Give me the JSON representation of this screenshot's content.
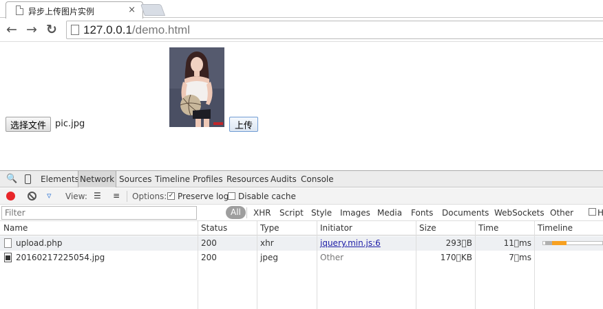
{
  "browser": {
    "tab_title": "异步上传图片实例",
    "tab_close": "×",
    "url_host": "127.0.0.1",
    "url_path": "/demo.html",
    "back_glyph": "←",
    "forward_glyph": "→",
    "reload_glyph": "↻"
  },
  "page": {
    "file_button_label": "选择文件",
    "file_name": "pic.jpg",
    "upload_button_label": "上传"
  },
  "devtools": {
    "tabs": [
      "Elements",
      "Network",
      "Sources",
      "Timeline",
      "Profiles",
      "Resources",
      "Audits",
      "Console"
    ],
    "active_tab": "Network",
    "view_label": "View:",
    "options_label": "Options:",
    "preserve_log_label": "Preserve log",
    "preserve_log_checked": true,
    "disable_cache_label": "Disable cache",
    "disable_cache_checked": false,
    "filter_placeholder": "Filter",
    "type_filters": [
      "All",
      "XHR",
      "Script",
      "Style",
      "Images",
      "Media",
      "Fonts",
      "Documents",
      "WebSockets",
      "Other"
    ],
    "hide_data_label": "H",
    "columns": [
      "Name",
      "Status",
      "Type",
      "Initiator",
      "Size",
      "Time",
      "Timeline"
    ],
    "rows": [
      {
        "name": "upload.php",
        "status": "200",
        "type": "xhr",
        "initiator": "jquery.min.js:6",
        "size": "293\u0000B",
        "time": "11\u0000ms"
      },
      {
        "name": "20160217225054.jpg",
        "status": "200",
        "type": "jpeg",
        "initiator": "Other",
        "size": "170\u0000KB",
        "time": "7\u0000ms"
      }
    ],
    "colors": {
      "record": "#e8262a",
      "timeline_receive": "#f7a121",
      "timeline_wait": "#b0b0b0",
      "link": "#1a1aa6"
    }
  }
}
